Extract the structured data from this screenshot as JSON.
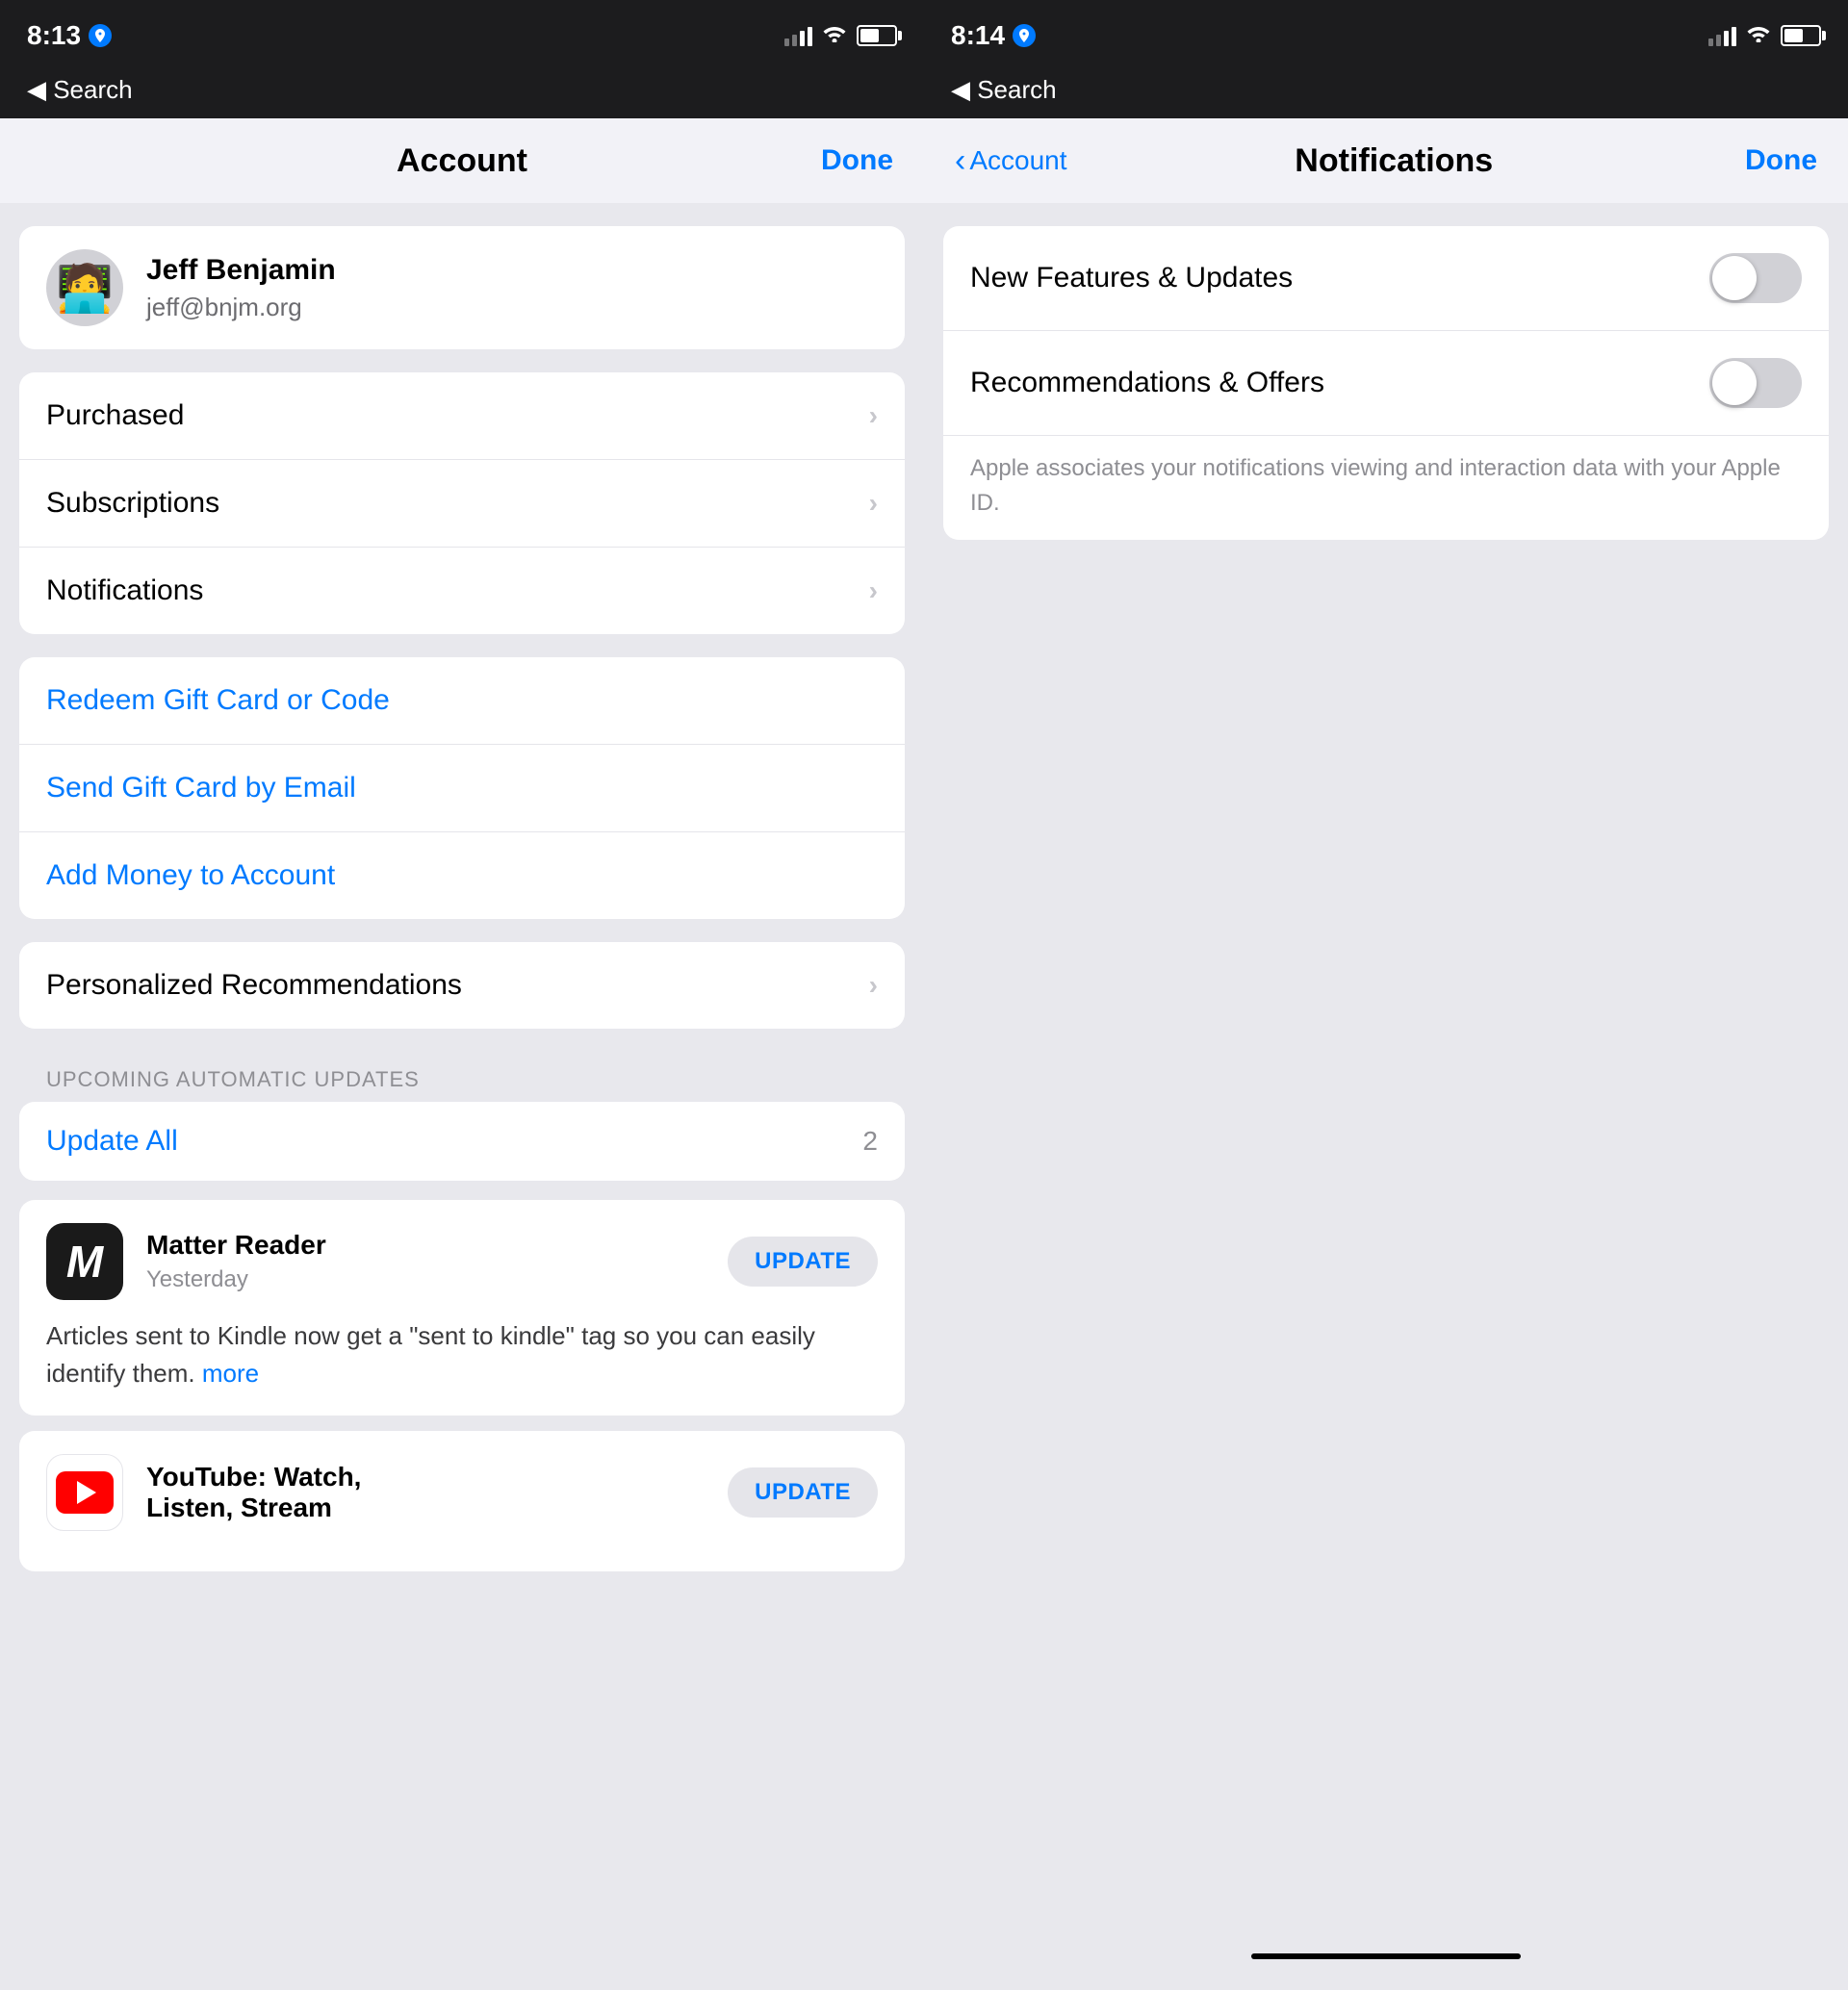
{
  "left_panel": {
    "status_bar": {
      "time": "8:13",
      "back_label": "◀ Search"
    },
    "nav": {
      "title": "Account",
      "done_label": "Done"
    },
    "user": {
      "name": "Jeff Benjamin",
      "email": "jeff@bnjm.org",
      "avatar_emoji": "🧑"
    },
    "menu_items": [
      {
        "label": "Purchased",
        "has_chevron": true
      },
      {
        "label": "Subscriptions",
        "has_chevron": true
      },
      {
        "label": "Notifications",
        "has_chevron": true
      }
    ],
    "gift_items": [
      {
        "label": "Redeem Gift Card or Code",
        "blue": true
      },
      {
        "label": "Send Gift Card by Email",
        "blue": true
      },
      {
        "label": "Add Money to Account",
        "blue": true
      }
    ],
    "recommendations": {
      "label": "Personalized Recommendations",
      "has_chevron": true
    },
    "upcoming_label": "UPCOMING AUTOMATIC UPDATES",
    "update_all": {
      "label": "Update All",
      "count": "2"
    },
    "apps": [
      {
        "name": "Matter Reader",
        "date": "Yesterday",
        "btn_label": "UPDATE",
        "description": "Articles sent to Kindle now get a \"sent to kindle\" tag so you can easily identify them.",
        "more_label": "more",
        "icon_type": "matter"
      },
      {
        "name": "YouTube: Watch, Listen, Stream",
        "date": "",
        "btn_label": "UPDATE",
        "icon_type": "youtube"
      }
    ]
  },
  "right_panel": {
    "status_bar": {
      "time": "8:14",
      "back_label": "◀ Search"
    },
    "nav": {
      "back_label": "Account",
      "title": "Notifications",
      "done_label": "Done"
    },
    "notification_items": [
      {
        "label": "New Features & Updates"
      },
      {
        "label": "Recommendations & Offers"
      }
    ],
    "footnote": "Apple associates your notifications viewing and interaction data with your Apple ID."
  }
}
